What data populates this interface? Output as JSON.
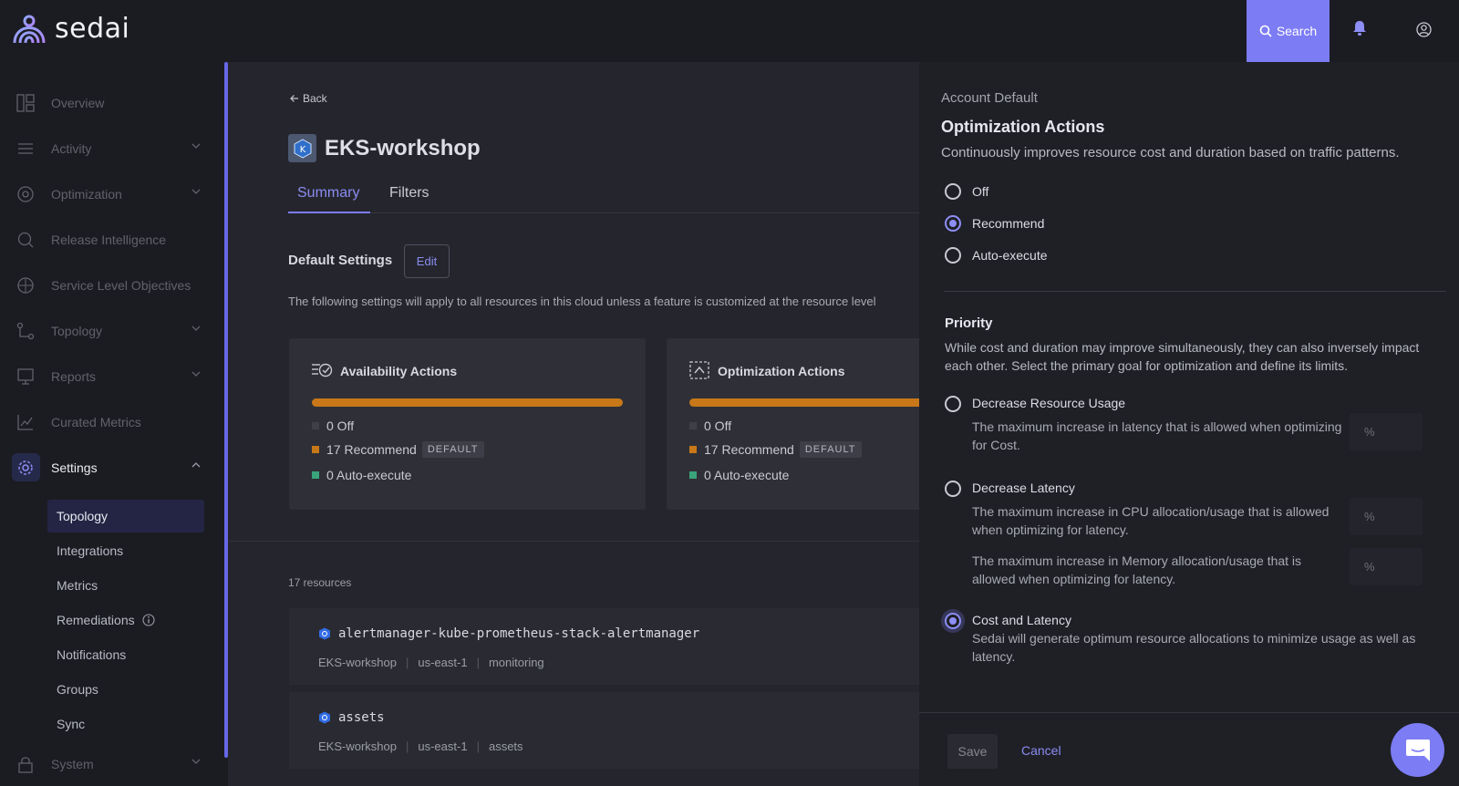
{
  "app": {
    "logo_text": "sedai",
    "search_label": "Search",
    "accent_color": "#7c7cf4"
  },
  "sidebar": {
    "items": [
      {
        "label": "Overview",
        "icon": "grid-icon"
      },
      {
        "label": "Activity",
        "icon": "list-icon"
      },
      {
        "label": "Optimization",
        "icon": "optimization-icon"
      },
      {
        "label": "Release Intelligence",
        "icon": "release-icon"
      },
      {
        "label": "Service Level Objectives",
        "icon": "target-icon"
      },
      {
        "label": "Topology",
        "icon": "topology-icon"
      },
      {
        "label": "Reports",
        "icon": "reports-icon"
      },
      {
        "label": "Curated Metrics",
        "icon": "chart-icon"
      },
      {
        "label": "Settings",
        "icon": "gear-icon"
      },
      {
        "label": "System",
        "icon": "lock-icon"
      }
    ],
    "settings_sub": [
      "Topology",
      "Integrations",
      "Metrics",
      "Remediations",
      "Notifications",
      "Groups",
      "Sync"
    ]
  },
  "main": {
    "back_label": "Back",
    "title": "EKS-workshop",
    "tabs": [
      "Summary",
      "Filters"
    ],
    "default_settings_title": "Default Settings",
    "edit_label": "Edit",
    "description": "The following settings will apply to all resources in this cloud unless a feature is customized at the resource level",
    "cards": [
      {
        "title": "Availability Actions",
        "off": "0 Off",
        "recommend": "17 Recommend",
        "auto": "0 Auto-execute",
        "tag": "DEFAULT"
      },
      {
        "title": "Optimization Actions",
        "off": "0 Off",
        "recommend": "17 Recommend",
        "auto": "0 Auto-execute",
        "tag": "DEFAULT"
      }
    ],
    "resource_count": "17 resources",
    "resources": [
      {
        "name": "alertmanager-kube-prometheus-stack-alertmanager",
        "cluster": "EKS-workshop",
        "region": "us-east-1",
        "namespace": "monitoring"
      },
      {
        "name": "assets",
        "cluster": "EKS-workshop",
        "region": "us-east-1",
        "namespace": "assets"
      }
    ]
  },
  "panel": {
    "account_label": "Account Default",
    "title": "Optimization Actions",
    "description": "Continuously improves resource cost and duration based on traffic patterns.",
    "modes": [
      "Off",
      "Recommend",
      "Auto-execute"
    ],
    "selected_mode": "Recommend",
    "priority_title": "Priority",
    "priority_desc": "While cost and duration may improve simultaneously, they can also inversely impact each other. Select the primary goal for optimization and define its limits.",
    "options": [
      {
        "label": "Decrease Resource Usage",
        "desc": "The maximum increase in latency that is allowed when optimizing for Cost."
      },
      {
        "label": "Decrease Latency",
        "desc": "The maximum increase in CPU allocation/usage that is allowed when optimizing for latency.",
        "desc2": "The maximum increase in Memory allocation/usage that is allowed when optimizing for latency."
      },
      {
        "label": "Cost and Latency",
        "desc": "Sedai will generate optimum resource allocations to minimize usage as well as latency."
      }
    ],
    "selected_priority": "Cost and Latency",
    "pct_placeholder": "%",
    "save_label": "Save",
    "cancel_label": "Cancel"
  }
}
